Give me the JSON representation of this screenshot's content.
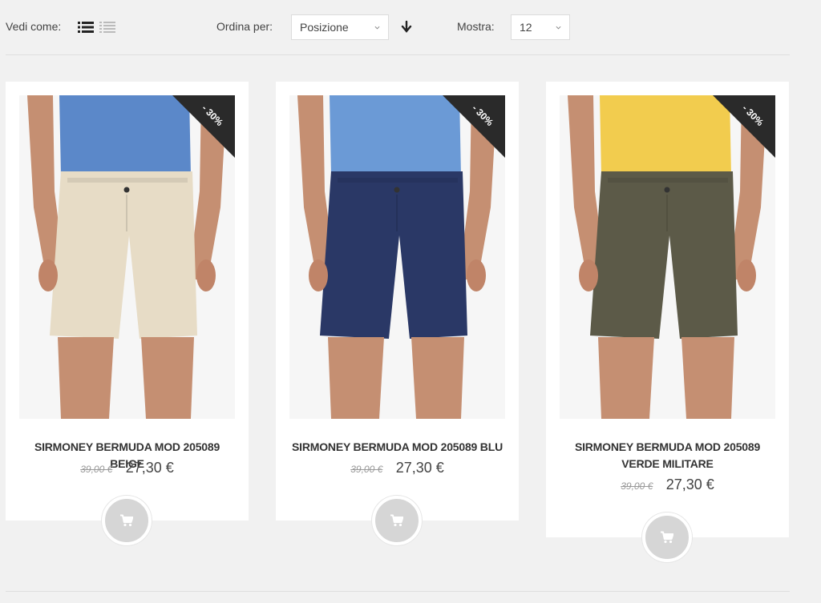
{
  "toolbar": {
    "view_label": "Vedi come:",
    "sort_label": "Ordina per:",
    "sort_value": "Posizione",
    "show_label": "Mostra:",
    "show_value": "12"
  },
  "products": [
    {
      "name": "SIRMONEY BERMUDA MOD 205089 BEIGE",
      "old_price": "39,00 €",
      "price": "27,30 €",
      "discount": "- 30%",
      "shirt_color": "#5b88c9",
      "shorts_color": "#e7dcc6"
    },
    {
      "name": "SIRMONEY BERMUDA MOD 205089 BLU",
      "old_price": "39,00 €",
      "price": "27,30 €",
      "discount": "- 30%",
      "shirt_color": "#6b9ad6",
      "shorts_color": "#2a3866"
    },
    {
      "name": "SIRMONEY BERMUDA MOD 205089 VERDE MILITARE",
      "old_price": "39,00 €",
      "price": "27,30 €",
      "discount": "- 30%",
      "shirt_color": "#f2cc4e",
      "shorts_color": "#5c5a48"
    }
  ],
  "icons": {
    "list_view": "list-view-icon",
    "grid_view": "grid-view-icon",
    "sort_direction": "arrow-down-icon",
    "cart": "cart-icon"
  }
}
